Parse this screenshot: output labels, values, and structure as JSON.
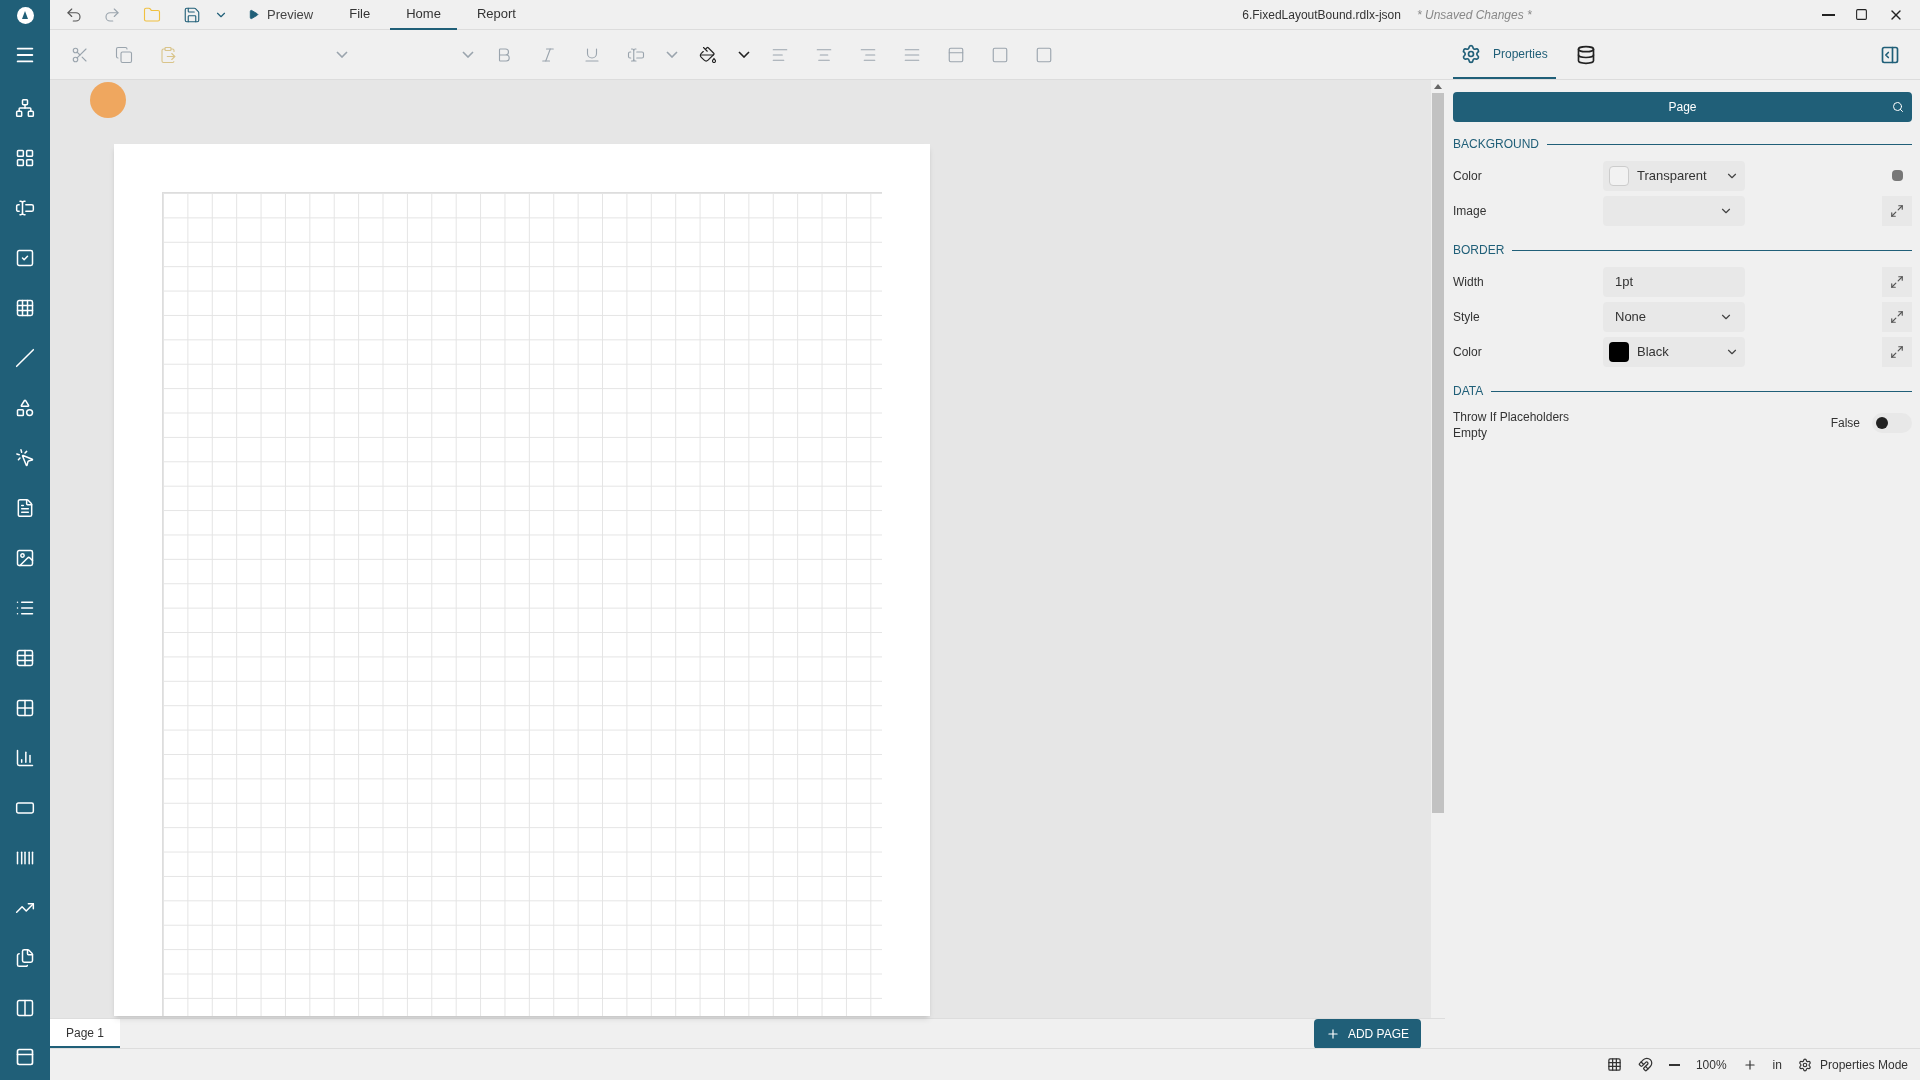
{
  "title_bar": {
    "file_name": "6.FixedLayoutBound.rdlx-json",
    "status": "* Unsaved Changes *"
  },
  "preview": "Preview",
  "tabs": [
    {
      "label": "File",
      "selected": false
    },
    {
      "label": "Home",
      "selected": true
    },
    {
      "label": "Report",
      "selected": false
    }
  ],
  "panel_tabs": {
    "properties": {
      "label": "Properties",
      "selected": true
    },
    "data_selected": false
  },
  "object_selector": "Page",
  "sections": [
    {
      "title": "BACKGROUND",
      "properties": [
        {
          "label": "Color",
          "kind": "color-select",
          "value": "Transparent",
          "expandable": false
        },
        {
          "label": "Image",
          "kind": "select",
          "expandable": true
        }
      ]
    },
    {
      "title": "BORDER",
      "properties": [
        {
          "label": "Width",
          "kind": "text",
          "value": "1pt",
          "expandable": true
        },
        {
          "label": "Style",
          "kind": "select",
          "value": "None",
          "expandable": true
        },
        {
          "label": "Color",
          "kind": "color-select",
          "value": "Black",
          "color": "#000000",
          "expandable": true
        }
      ]
    },
    {
      "title": "DATA",
      "properties": [
        {
          "label": "Throw If Placeholders Empty",
          "kind": "toggle",
          "value": "False",
          "on": false
        }
      ]
    }
  ],
  "page_tabs": [
    {
      "label": "Page 1",
      "selected": true
    }
  ],
  "add_page": "ADD PAGE",
  "status_bar": {
    "zoom": "100%",
    "unit": "in",
    "mode": "Properties Mode"
  }
}
